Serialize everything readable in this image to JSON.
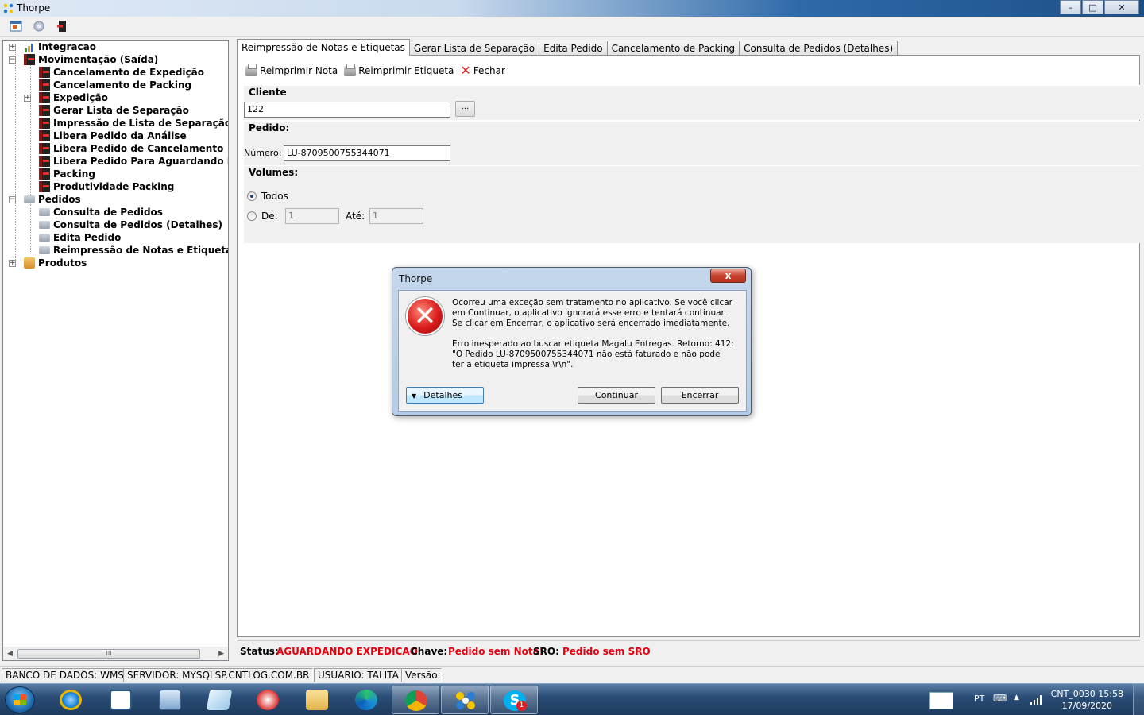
{
  "window": {
    "title": "Thorpe",
    "minimize": "–",
    "maximize": "□",
    "close": "✕"
  },
  "tree": {
    "items": [
      {
        "label": "Integracao",
        "icon": "chart-icon"
      },
      {
        "label": "Movimentação (Saída)",
        "icon": "exit-icon"
      },
      {
        "label": "Cancelamento de Expedição",
        "icon": "exit-icon"
      },
      {
        "label": "Cancelamento de Packing",
        "icon": "exit-icon"
      },
      {
        "label": "Expedição",
        "icon": "exit-icon"
      },
      {
        "label": "Gerar Lista de Separação",
        "icon": "exit-icon"
      },
      {
        "label": "Impressão de Lista de Separação",
        "icon": "exit-icon"
      },
      {
        "label": "Libera Pedido da Análise",
        "icon": "exit-icon"
      },
      {
        "label": "Libera Pedido de Cancelamento",
        "icon": "exit-icon"
      },
      {
        "label": "Libera Pedido Para Aguardando Exped",
        "icon": "exit-icon"
      },
      {
        "label": "Packing",
        "icon": "exit-icon"
      },
      {
        "label": "Produtividade Packing",
        "icon": "exit-icon"
      },
      {
        "label": "Pedidos",
        "icon": "cart-icon"
      },
      {
        "label": "Consulta de Pedidos",
        "icon": "cart-icon"
      },
      {
        "label": "Consulta de Pedidos (Detalhes)",
        "icon": "cart-icon"
      },
      {
        "label": "Edita Pedido",
        "icon": "cart-icon"
      },
      {
        "label": "Reimpressão de Notas e Etiquetas",
        "icon": "cart-icon"
      },
      {
        "label": "Produtos",
        "icon": "box-icon"
      }
    ],
    "scroll_thumb": "III"
  },
  "tabs": [
    "Reimpressão de Notas e Etiquetas",
    "Gerar Lista de Separação",
    "Edita Pedido",
    "Cancelamento de Packing",
    "Consulta de Pedidos (Detalhes)"
  ],
  "actions": {
    "reprint_note": "Reimprimir Nota",
    "reprint_label": "Reimprimir Etiqueta",
    "close": "Fechar"
  },
  "cliente": {
    "title": "Cliente",
    "value": "122",
    "browse": "..."
  },
  "pedido": {
    "title": "Pedido:",
    "numero_label": "Número:",
    "numero_value": "LU-8709500755344071"
  },
  "volumes": {
    "title": "Volumes:",
    "todos_label": "Todos",
    "de_label": "De:",
    "de_value": "1",
    "ate_label": "Até:",
    "ate_value": "1",
    "selected": "Todos"
  },
  "status": {
    "status_label": "Status:",
    "status_value": "AGUARDANDO EXPEDICAO",
    "chave_label": "Chave:",
    "chave_value": "Pedido sem Nota!",
    "sro_label": "SRO:",
    "sro_value": "Pedido sem SRO"
  },
  "appstatus": {
    "banco": "BANCO DE DADOS: WMS",
    "servidor": "SERVIDOR: MYSQLSP.CNTLOG.COM.BR",
    "usuario": "USUARIO: TALITA",
    "versao": "Versão:"
  },
  "dialog": {
    "title": "Thorpe",
    "close": "x",
    "message1": "Ocorreu uma exceção sem tratamento no aplicativo. Se você clicar em Continuar, o aplicativo ignorará esse erro e tentará continuar. Se clicar em Encerrar, o aplicativo será encerrado imediatamente.",
    "message2": "Erro inesperado ao buscar etiqueta Magalu Entregas. Retorno: 412: \"O Pedido LU-8709500755344071 não está faturado e não pode ter a etiqueta impressa.\\r\\n\".",
    "details": "Detalhes",
    "continue": "Continuar",
    "quit": "Encerrar"
  },
  "taskbar": {
    "language": "PT",
    "clock_line1": "CNT_0030 15:58",
    "clock_line2": "17/09/2020",
    "skype_badge": "1"
  },
  "colors": {
    "status_red": "#e3000f",
    "taskbar": "#1e3b5e",
    "dialog_frame": "#b3cbe5"
  }
}
